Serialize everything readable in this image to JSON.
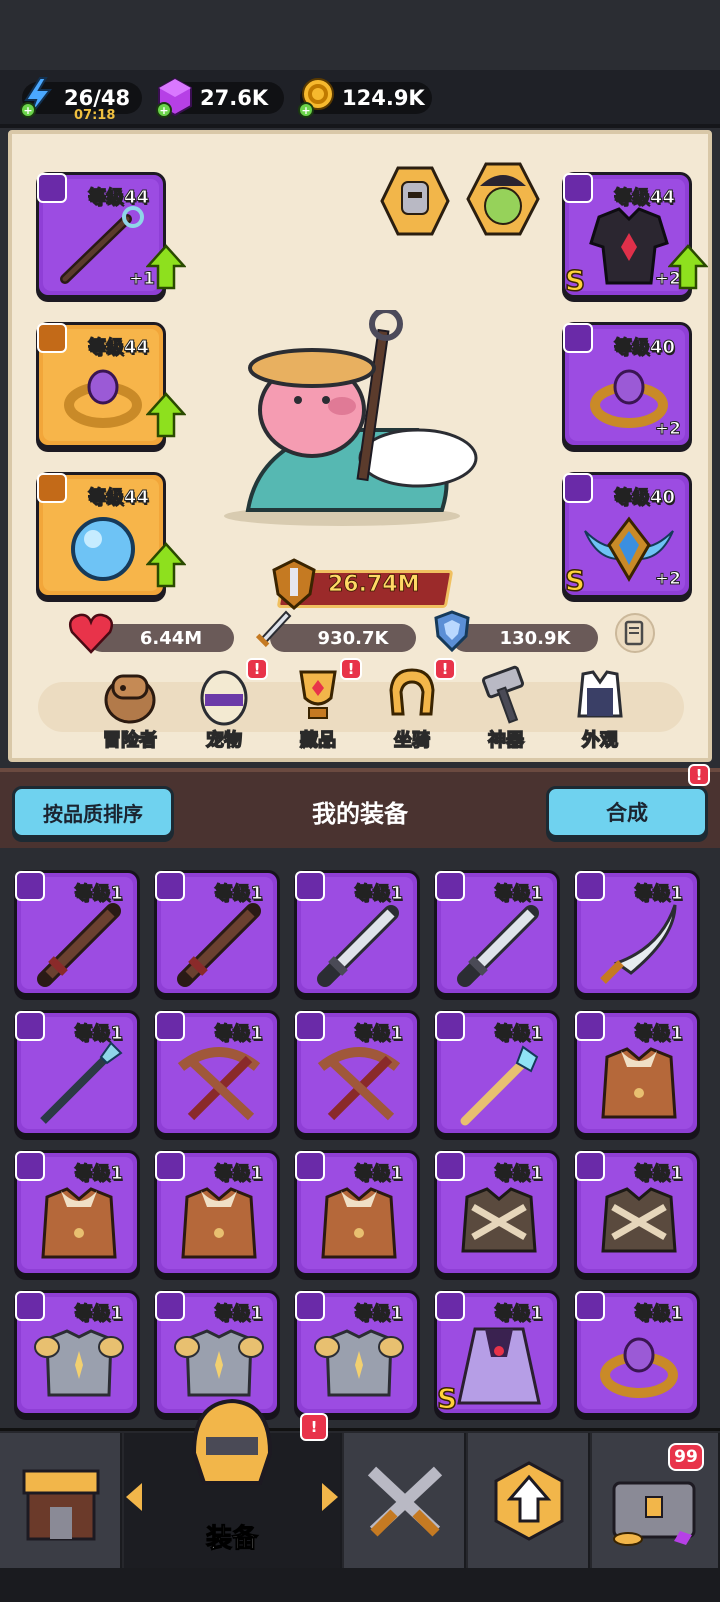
{
  "resources": {
    "energy": {
      "value": "26/48",
      "timer": "07:18",
      "icon": "lightning-icon"
    },
    "gems": {
      "value": "27.6K",
      "icon": "gem-cube-icon"
    },
    "gold": {
      "value": "124.9K",
      "icon": "coin-icon"
    }
  },
  "hero_slots": {
    "weapon": {
      "level": "等级44",
      "plus": "+1"
    },
    "armor": {
      "level": "等级44",
      "plus": "+2",
      "rank": "S"
    },
    "ring_left": {
      "level": "等级44"
    },
    "ring_right": {
      "level": "等级40",
      "plus": "+2"
    },
    "necklace": {
      "level": "等级44"
    },
    "wings": {
      "level": "等级40",
      "plus": "+2",
      "rank": "S"
    }
  },
  "power": "26.74M",
  "stats": {
    "hp": "6.44M",
    "attack": "930.7K",
    "defense": "130.9K"
  },
  "categories": [
    {
      "label": "冒险者",
      "icon": "capybara-icon",
      "alert": false
    },
    {
      "label": "宠物",
      "icon": "pet-egg-icon",
      "alert": true
    },
    {
      "label": "藏品",
      "icon": "trophy-icon",
      "alert": true
    },
    {
      "label": "坐骑",
      "icon": "horseshoe-icon",
      "alert": true
    },
    {
      "label": "神器",
      "icon": "hammer-icon",
      "alert": false
    },
    {
      "label": "外观",
      "icon": "outfit-icon",
      "alert": false
    }
  ],
  "alert_mark": "!",
  "equipment": {
    "sort_label": "按品质排序",
    "title": "我的装备",
    "merge_label": "合成",
    "items": [
      {
        "level": "等级1",
        "kind": "wood-sword"
      },
      {
        "level": "等级1",
        "kind": "wood-sword"
      },
      {
        "level": "等级1",
        "kind": "steel-sword"
      },
      {
        "level": "等级1",
        "kind": "steel-sword"
      },
      {
        "level": "等级1",
        "kind": "scimitar"
      },
      {
        "level": "等级1",
        "kind": "spear"
      },
      {
        "level": "等级1",
        "kind": "crossbow"
      },
      {
        "level": "等级1",
        "kind": "crossbow"
      },
      {
        "level": "等级1",
        "kind": "crystal-staff"
      },
      {
        "level": "等级1",
        "kind": "fur-armor"
      },
      {
        "level": "等级1",
        "kind": "fur-armor"
      },
      {
        "level": "等级1",
        "kind": "fur-armor"
      },
      {
        "level": "等级1",
        "kind": "fur-armor"
      },
      {
        "level": "等级1",
        "kind": "bone-armor"
      },
      {
        "level": "等级1",
        "kind": "bone-armor"
      },
      {
        "level": "等级1",
        "kind": "plate-armor"
      },
      {
        "level": "等级1",
        "kind": "plate-armor"
      },
      {
        "level": "等级1",
        "kind": "plate-armor"
      },
      {
        "level": "等级1",
        "kind": "cape",
        "rank": "S"
      },
      {
        "level": "等级1",
        "kind": "ring"
      }
    ]
  },
  "nav": {
    "shop": {
      "icon": "shop-icon"
    },
    "equipment": {
      "label": "装备",
      "icon": "helmet-icon",
      "alert": "!"
    },
    "battle": {
      "icon": "crossed-swords-icon"
    },
    "upgrade": {
      "icon": "upgrade-arrow-icon"
    },
    "chest": {
      "icon": "treasure-chest-icon",
      "count": "99"
    }
  },
  "colors": {
    "epic_purple": "#8f3fd6",
    "legend_orange": "#f2a63a",
    "button_cyan": "#6fd2ef",
    "alert_red": "#e8334a"
  }
}
